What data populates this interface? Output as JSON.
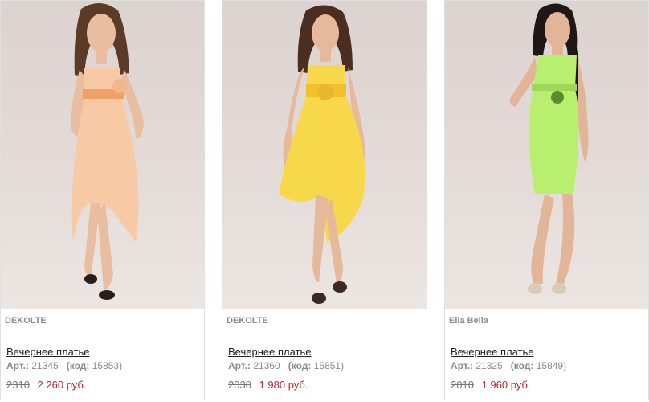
{
  "products": [
    {
      "brand": "DEKOLTE",
      "title": "Вечернее платье",
      "art_label": "Арт.:",
      "art": "21345",
      "code_label": "(код:",
      "code": "15853)",
      "old_price": "2310",
      "new_price": "2 260 руб.",
      "dress_color": "#f7c9a4",
      "sash_color": "#f2a06a"
    },
    {
      "brand": "DEKOLTE",
      "title": "Вечернее платье",
      "art_label": "Арт.:",
      "art": "21360",
      "code_label": "(код:",
      "code": "15851)",
      "old_price": "2030",
      "new_price": "1 980 руб.",
      "dress_color": "#f6d84a",
      "sash_color": "#f0c12a"
    },
    {
      "brand": "Ella Bella",
      "title": "Вечернее платье",
      "art_label": "Арт.:",
      "art": "21325",
      "code_label": "(код:",
      "code": "15849)",
      "old_price": "2010",
      "new_price": "1 960 руб.",
      "dress_color": "#b8ef6e",
      "sash_color": "#9fd858"
    }
  ],
  "colors": {
    "brand_text": "#8a8a8a",
    "old_price": "#777777",
    "new_price": "#c0262e",
    "photo_bg": "#dcd3d0"
  }
}
